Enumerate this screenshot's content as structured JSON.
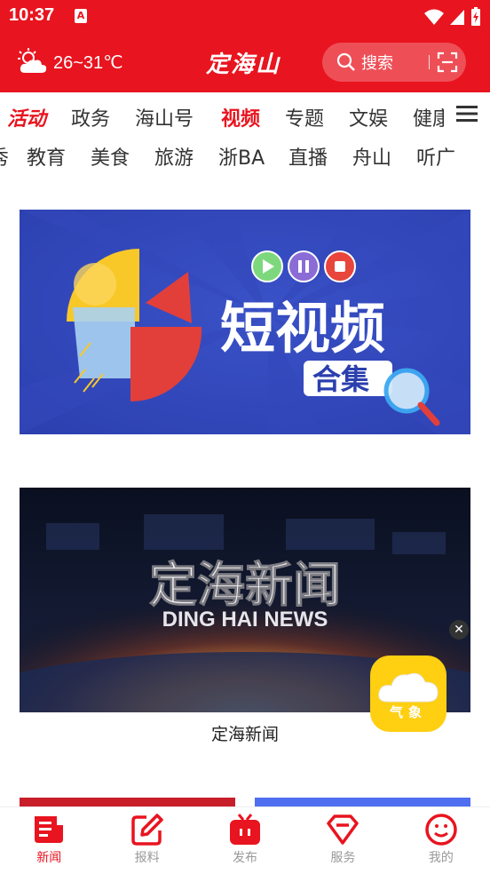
{
  "status_bar": {
    "time": "10:37",
    "notification_icon": "A"
  },
  "header": {
    "weather_icon": "cloud-sun-icon",
    "temperature": "26~31℃",
    "app_logo": "定海山",
    "search_label": "搜索",
    "scan_icon": "scan-icon",
    "accent_color": "#e8141f"
  },
  "tabs_row1": [
    "活动",
    "政务",
    "海山号",
    "视频",
    "专题",
    "文娱",
    "健康"
  ],
  "tabs_row2": [
    "秀",
    "教育",
    "美食",
    "旅游",
    "浙BA",
    "直播",
    "舟山",
    "听广"
  ],
  "active_tab": "视频",
  "banner1": {
    "title": "短视频",
    "subtitle": "合集"
  },
  "banner2": {
    "title": "定海新闻",
    "subtitle": "DING HAI NEWS",
    "caption": "定海新闻"
  },
  "weather_widget": {
    "label": "气象"
  },
  "bottom_nav": [
    {
      "label": "新闻",
      "icon": "news-icon",
      "active": true
    },
    {
      "label": "报料",
      "icon": "edit-icon",
      "active": false
    },
    {
      "label": "发布",
      "icon": "tv-icon",
      "active": false
    },
    {
      "label": "服务",
      "icon": "service-icon",
      "active": false
    },
    {
      "label": "我的",
      "icon": "profile-icon",
      "active": false
    }
  ]
}
